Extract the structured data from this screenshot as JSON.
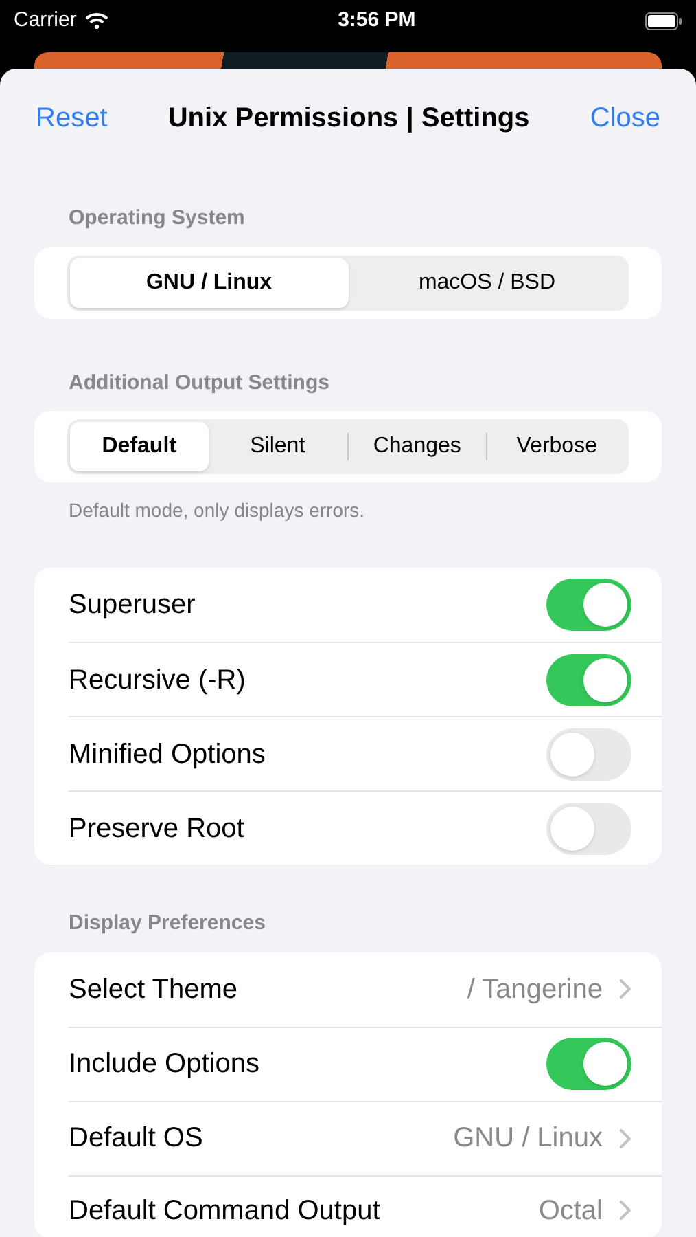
{
  "status_bar": {
    "carrier": "Carrier",
    "time": "3:56 PM"
  },
  "nav": {
    "left": "Reset",
    "title": "Unix Permissions | Settings",
    "right": "Close"
  },
  "operating_system": {
    "header": "Operating System",
    "options": [
      {
        "label": "GNU / Linux",
        "selected": true
      },
      {
        "label": "macOS / BSD",
        "selected": false
      }
    ]
  },
  "output_settings": {
    "header": "Additional Output Settings",
    "options": [
      {
        "label": "Default",
        "selected": true
      },
      {
        "label": "Silent",
        "selected": false
      },
      {
        "label": "Changes",
        "selected": false
      },
      {
        "label": "Verbose",
        "selected": false
      }
    ],
    "footer": "Default mode, only displays errors."
  },
  "toggles": [
    {
      "label": "Superuser",
      "on": true
    },
    {
      "label": "Recursive (-R)",
      "on": true
    },
    {
      "label": "Minified Options",
      "on": false
    },
    {
      "label": "Preserve Root",
      "on": false
    }
  ],
  "display_preferences": {
    "header": "Display Preferences",
    "rows": [
      {
        "kind": "link",
        "label": "Select Theme",
        "value": "/ Tangerine"
      },
      {
        "kind": "toggle",
        "label": "Include Options",
        "on": true
      },
      {
        "kind": "link",
        "label": "Default OS",
        "value": "GNU / Linux"
      },
      {
        "kind": "link",
        "label": "Default Command Output",
        "value": "Octal"
      }
    ]
  }
}
